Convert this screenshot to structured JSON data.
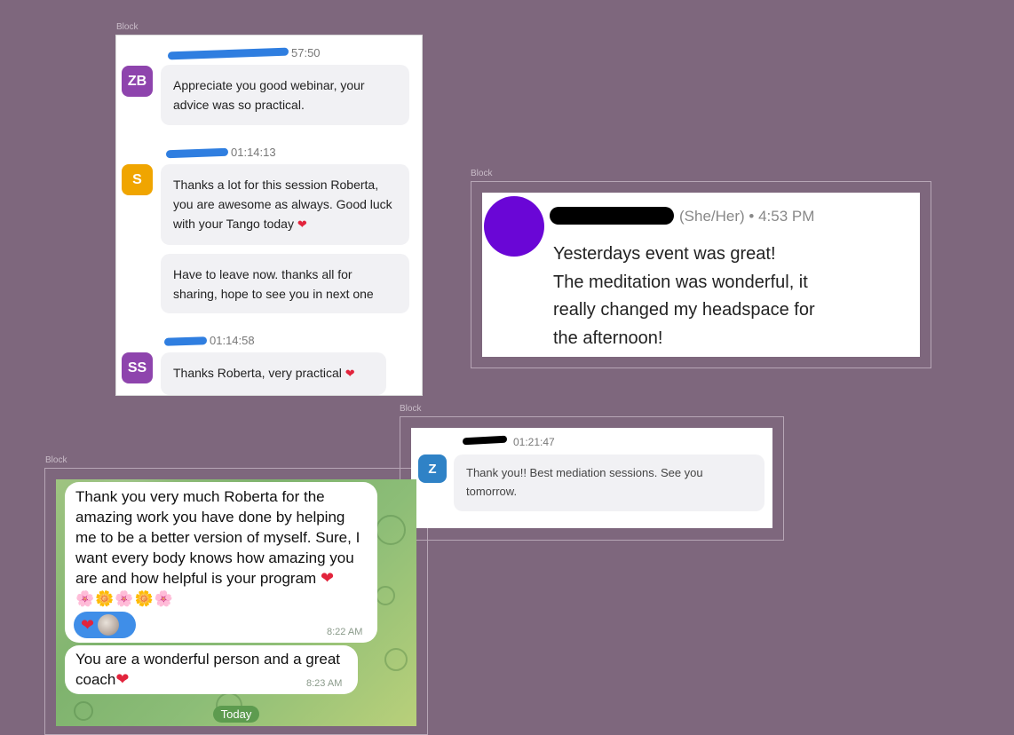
{
  "block_label": "Block",
  "card1": {
    "messages": [
      {
        "avatar": "ZB",
        "avatar_color": "#8e44ad",
        "time": "57:50",
        "text": "Appreciate you good webinar, your advice was so practical."
      },
      {
        "avatar": "S",
        "avatar_color": "#f0a500",
        "time": "01:14:13",
        "text": "Thanks a lot for this session Roberta, you are awesome as always. Good luck with your Tango today",
        "followup": "Have to leave now. thanks all for sharing, hope to see you in next one"
      },
      {
        "avatar": "SS",
        "avatar_color": "#8e44ad",
        "time": "01:14:58",
        "text": "Thanks Roberta, very practical"
      }
    ]
  },
  "card2": {
    "meta": "(She/Her) • 4:53 PM",
    "lines": [
      "Yesterdays event was great!",
      "The meditation was wonderful, it",
      "really changed my headspace for",
      "the afternoon!"
    ]
  },
  "card3": {
    "avatar": "Z",
    "time": "01:21:47",
    "text": "Thank you!! Best mediation sessions. See you tomorrow."
  },
  "card4": {
    "message1": {
      "lines": [
        "Thank you very much Roberta for the",
        "amazing work you have done by helping",
        "me to be a better version of myself. Sure, I",
        "want every body knows how amazing you",
        "are and how helpful is your program"
      ],
      "flowers": "🌸🌼🌸🌼🌸",
      "time": "8:22 AM"
    },
    "message2": {
      "lines": [
        "You are a wonderful person and a great",
        "coach"
      ],
      "time": "8:23 AM"
    },
    "date_badge": "Today"
  },
  "colors": {
    "background": "#7e677d",
    "heart": "#e2243c",
    "telegram_green": "#8cbd77",
    "redaction_blue": "#2f7ee0"
  },
  "icons": [
    "heart-icon",
    "flower-emoji",
    "avatar"
  ]
}
